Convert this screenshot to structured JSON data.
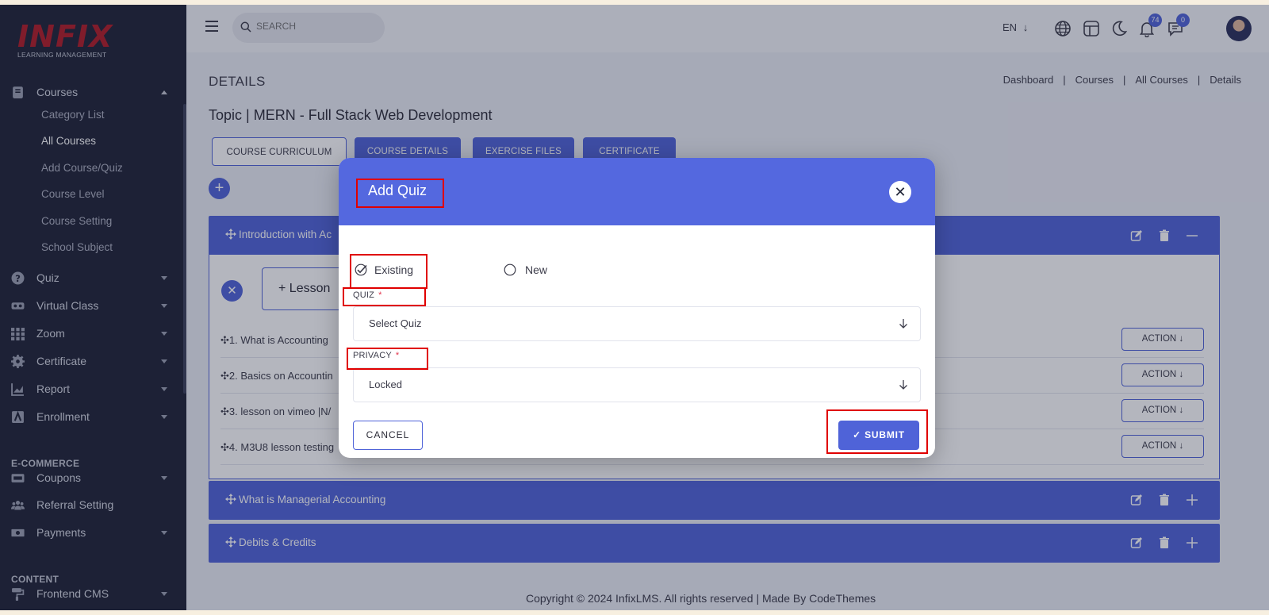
{
  "brand": {
    "logo_text": "INFIX",
    "logo_sub": "LEARNING MANAGEMENT"
  },
  "sidebar": {
    "items": [
      {
        "label": "Courses",
        "icon": "book-icon",
        "expanded": true
      },
      {
        "label": "Quiz",
        "icon": "question-icon"
      },
      {
        "label": "Virtual Class",
        "icon": "vr-icon"
      },
      {
        "label": "Zoom",
        "icon": "grid-icon"
      },
      {
        "label": "Certificate",
        "icon": "gear-icon"
      },
      {
        "label": "Report",
        "icon": "chart-icon"
      },
      {
        "label": "Enrollment",
        "icon": "enroll-icon"
      }
    ],
    "courses_sub": [
      "Category List",
      "All Courses",
      "Add Course/Quiz",
      "Course Level",
      "Course Setting",
      "School Subject"
    ],
    "ecommerce_title": "E-COMMERCE",
    "ecommerce_items": [
      {
        "label": "Coupons",
        "icon": "ticket-icon"
      },
      {
        "label": "Referral Setting",
        "icon": "users-icon"
      },
      {
        "label": "Payments",
        "icon": "money-icon"
      }
    ],
    "content_title": "CONTENT",
    "content_items": [
      {
        "label": "Frontend CMS",
        "icon": "paint-roller-icon"
      }
    ]
  },
  "topbar": {
    "search_placeholder": "SEARCH",
    "language": "EN",
    "notification_count": "74",
    "message_count": "0"
  },
  "main": {
    "page_title": "DETAILS",
    "breadcrumbs": [
      "Dashboard",
      "Courses",
      "All Courses",
      "Details"
    ],
    "topic_title": "Topic | MERN - Full Stack Web Development",
    "tabs": [
      {
        "label": "COURSE CURRICULUM",
        "active": true
      },
      {
        "label": "COURSE DETAILS"
      },
      {
        "label": "EXERCISE FILES"
      },
      {
        "label": "CERTIFICATE"
      }
    ],
    "chapters": [
      {
        "title": "Introduction with Ac"
      },
      {
        "title": "What is Managerial Accounting"
      },
      {
        "title": "Debits & Credits"
      }
    ],
    "lesson_button": "Lesson",
    "lessons": [
      {
        "title": "1. What is Accounting",
        "action": "ACTION"
      },
      {
        "title": "2. Basics on Accountin",
        "action": "ACTION"
      },
      {
        "title": "3. lesson on vimeo |N/",
        "action": "ACTION"
      },
      {
        "title": "4. M3U8 lesson testing",
        "action": "ACTION"
      }
    ],
    "footer": "Copyright © 2024 InfixLMS. All rights reserved | Made By CodeThemes"
  },
  "modal": {
    "title": "Add Quiz",
    "option_existing": "Existing",
    "option_new": "New",
    "selected_option": "Existing",
    "quiz_label": "QUIZ",
    "quiz_value": "Select Quiz",
    "privacy_label": "PRIVACY",
    "privacy_value": "Locked",
    "required_mark": "*",
    "cancel_label": "CANCEL",
    "submit_label": "SUBMIT"
  },
  "colors": {
    "accent": "#4f63d8",
    "sidebar": "#1e2235",
    "highlight": "#e00000",
    "brand": "#b21a25"
  }
}
